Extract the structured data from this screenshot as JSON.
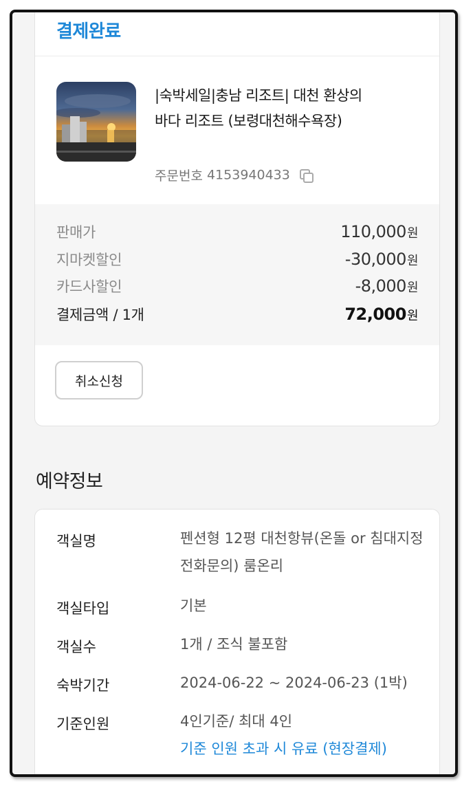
{
  "payment": {
    "status": "결제완료",
    "product_title": "|숙박세일|충남 리조트| 대천 환상의 바다 리조트 (보령대천해수욕장)",
    "order_label": "주문번호",
    "order_number": "4153940433",
    "prices": [
      {
        "label": "판매가",
        "amount": "110,000",
        "unit": "원"
      },
      {
        "label": "지마켓할인",
        "amount": "-30,000",
        "unit": "원"
      },
      {
        "label": "카드사할인",
        "amount": "-8,000",
        "unit": "원"
      }
    ],
    "total": {
      "label": "결제금액 / 1개",
      "amount": "72,000",
      "unit": "원"
    },
    "cancel_label": "취소신청"
  },
  "reservation": {
    "title": "예약정보",
    "rows": [
      {
        "label": "객실명",
        "value": "펜션형 12평 대천항뷰(온돌 or 침대지정 전화문의) 룸온리"
      },
      {
        "label": "객실타입",
        "value": "기본"
      },
      {
        "label": "객실수",
        "value": "1개 / 조식 불포함"
      },
      {
        "label": "숙박기간",
        "value": "2024-06-22 ~ 2024-06-23 (1박)"
      },
      {
        "label": "기준인원",
        "value": "4인기준/ 최대 4인",
        "note": "기준 인원 초과 시 유료 (현장결제)"
      }
    ]
  },
  "colors": {
    "accent": "#1e88d8",
    "card_bg": "#ffffff",
    "page_bg": "#f4f4f4"
  },
  "icons": [
    "copy-icon"
  ]
}
